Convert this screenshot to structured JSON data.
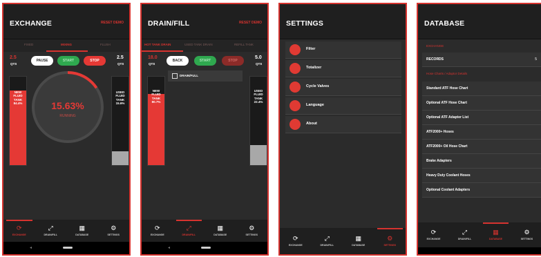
{
  "colors": {
    "accent": "#d7332f",
    "green": "#2fa84f",
    "panel": "#2b2b2b"
  },
  "nav": [
    {
      "label": "EXCHANGE",
      "icon": "refresh-icon"
    },
    {
      "label": "DRAIN/FILL",
      "icon": "arrows-icon"
    },
    {
      "label": "DATABASE",
      "icon": "database-icon"
    },
    {
      "label": "SETTINGS",
      "icon": "gear-icon"
    }
  ],
  "screens": {
    "exchange": {
      "title": "EXCHANGE",
      "action": "RESET DEMO",
      "tabs": [
        "FIXED",
        "MIXING",
        "FLUSH"
      ],
      "left_qts": "2.5",
      "left_unit": "QTS",
      "right_qts": "2.5",
      "right_unit": "QTS",
      "buttons": {
        "pause": "PAUSE",
        "start": "START",
        "stop": "STOP"
      },
      "percent": "15.63%",
      "status": "RUNNING",
      "progress": 0.156,
      "left_tank": {
        "label": "NEW FLUID TANK 84.4%",
        "level": 0.844
      },
      "right_tank": {
        "label": "USED FLUID TANK 15.6%",
        "level": 0.156
      }
    },
    "drainfill": {
      "title": "DRAIN/FILL",
      "action": "RESET DEMO",
      "tabs": [
        "HOT TANK DRAIN",
        "USED TANK DRAIN",
        "REFILL TANK"
      ],
      "left_qts": "18.0",
      "left_unit": "QTS",
      "right_qts": "5.0",
      "right_unit": "QTS",
      "buttons": {
        "back": "BACK",
        "start": "START",
        "stop": "STOP"
      },
      "option": "DRAIN/FULL",
      "left_tank": {
        "label": "NEW FLUID TANK 80.7%",
        "level": 0.807
      },
      "right_tank": {
        "label": "USED FLUID TANK 22.4%",
        "level": 0.224
      }
    },
    "settings": {
      "title": "SETTINGS",
      "items": [
        {
          "label": "Filter",
          "icon": "filter-icon"
        },
        {
          "label": "Totalizer",
          "icon": "totalizer-icon"
        },
        {
          "label": "Cycle Valves",
          "icon": "valve-icon"
        },
        {
          "label": "Language",
          "icon": "globe-icon"
        },
        {
          "label": "About",
          "icon": "info-icon"
        }
      ]
    },
    "database": {
      "title": "DATABASE",
      "section1": "EXCHANGE",
      "records_label": "RECORDS",
      "records_value": "5",
      "section2": "Hose Charts / Adaptor Details",
      "items": [
        "Standard ATF Hose Chart",
        "Optional ATF Hose Chart",
        "Optional ATF Adapter List",
        "ATF2000+ Hoses",
        "ATF2000+ Oil Hose Chart",
        "Brake Adapters",
        "Heavy Duty Coolant Hoses",
        "Optional Coolant Adapters"
      ]
    }
  }
}
